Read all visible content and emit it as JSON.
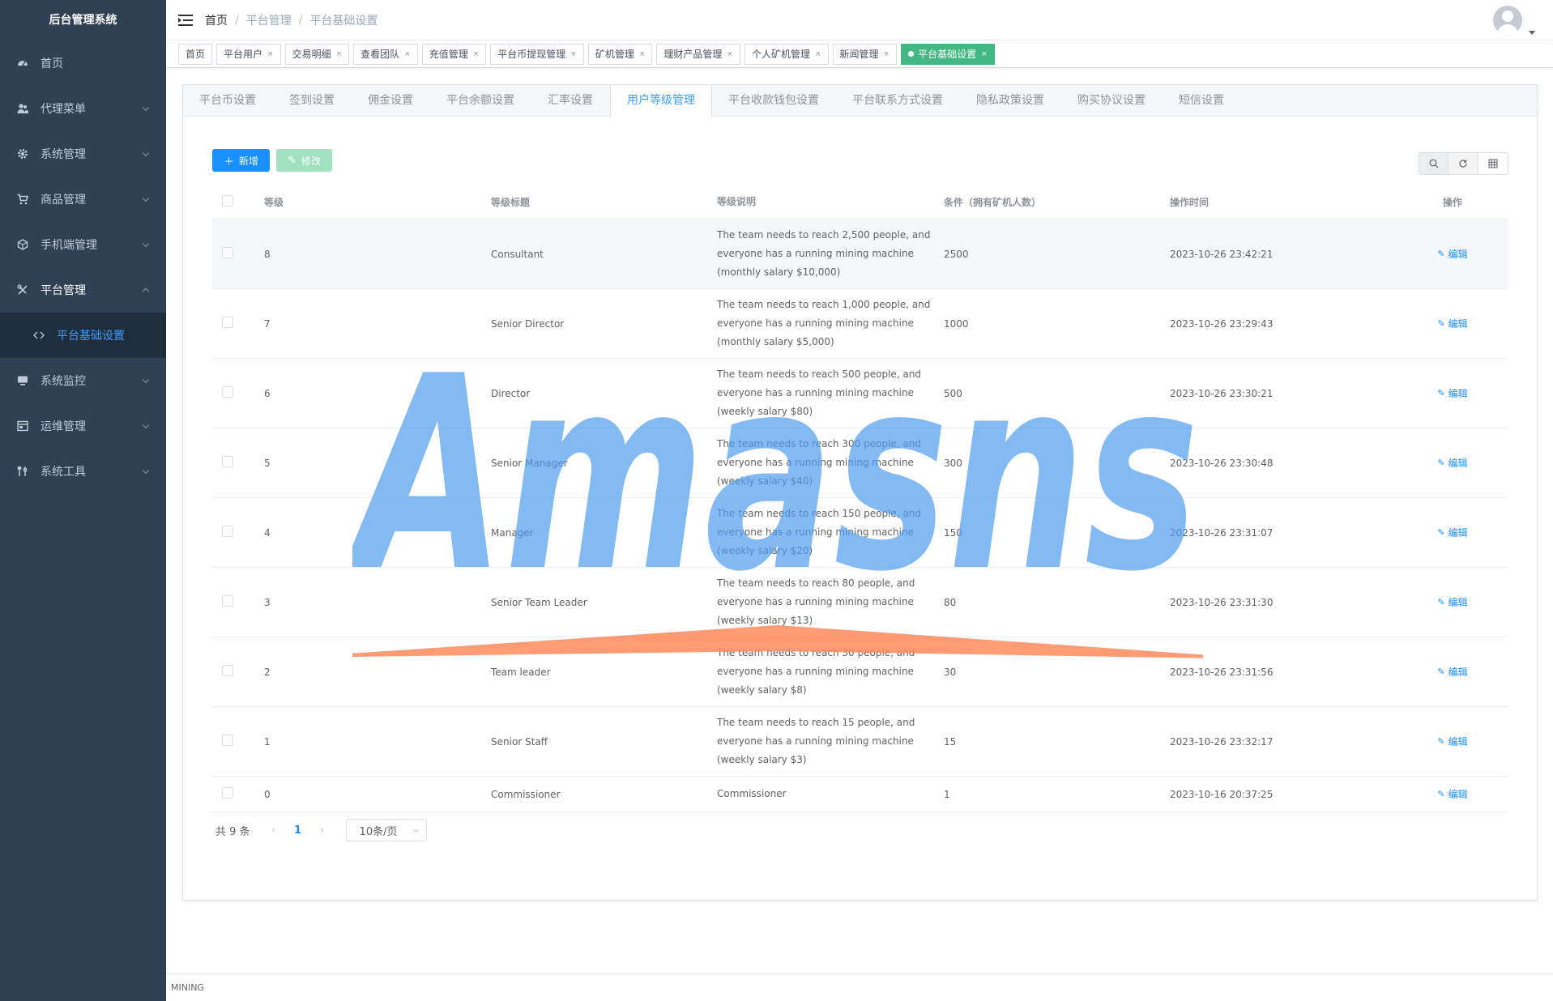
{
  "app": {
    "title": "后台管理系统"
  },
  "sidebar": {
    "items": [
      {
        "label": "首页",
        "icon": "dashboard-icon",
        "expandable": false
      },
      {
        "label": "代理菜单",
        "icon": "user-group-icon",
        "expandable": true
      },
      {
        "label": "系统管理",
        "icon": "gear-icon",
        "expandable": true
      },
      {
        "label": "商品管理",
        "icon": "cart-icon",
        "expandable": true
      },
      {
        "label": "手机端管理",
        "icon": "box-icon",
        "expandable": true
      },
      {
        "label": "平台管理",
        "icon": "tools-icon",
        "expandable": true,
        "expanded": true
      },
      {
        "label": "系统监控",
        "icon": "monitor-icon",
        "expandable": true
      },
      {
        "label": "运维管理",
        "icon": "server-icon",
        "expandable": true
      },
      {
        "label": "系统工具",
        "icon": "wrench-icon",
        "expandable": true
      }
    ],
    "sub_items": [
      {
        "label": "平台基础设置",
        "icon": "code-icon"
      }
    ]
  },
  "breadcrumb": [
    "首页",
    "平台管理",
    "平台基础设置"
  ],
  "tags": [
    {
      "label": "首页",
      "closable": false
    },
    {
      "label": "平台用户",
      "closable": true
    },
    {
      "label": "交易明细",
      "closable": true
    },
    {
      "label": "查看团队",
      "closable": true
    },
    {
      "label": "充值管理",
      "closable": true
    },
    {
      "label": "平台币提现管理",
      "closable": true
    },
    {
      "label": "矿机管理",
      "closable": true
    },
    {
      "label": "理财产品管理",
      "closable": true
    },
    {
      "label": "个人矿机管理",
      "closable": true
    },
    {
      "label": "新闻管理",
      "closable": true
    },
    {
      "label": "平台基础设置",
      "closable": true,
      "active": true
    }
  ],
  "tag_close_glyph": "×",
  "tabs": [
    "平台币设置",
    "签到设置",
    "佣金设置",
    "平台余额设置",
    "汇率设置",
    "用户等级管理",
    "平台收款钱包设置",
    "平台联系方式设置",
    "隐私政策设置",
    "购买协议设置",
    "短信设置"
  ],
  "active_tab_index": 5,
  "toolbar": {
    "add_label": "新增",
    "edit_label": "修改"
  },
  "table": {
    "columns": {
      "level": "等级",
      "title": "等级标题",
      "desc": "等级说明",
      "condition": "条件（拥有矿机人数）",
      "time": "操作时间",
      "op": "操作"
    },
    "edit_label": "编辑",
    "rows": [
      {
        "level": "8",
        "title": "Consultant",
        "desc": "The team needs to reach 2,500 people, and everyone has a running mining machine (monthly salary $10,000)",
        "condition": "2500",
        "time": "2023-10-26 23:42:21"
      },
      {
        "level": "7",
        "title": "Senior Director",
        "desc": "The team needs to reach 1,000 people, and everyone has a running mining machine (monthly salary $5,000)",
        "condition": "1000",
        "time": "2023-10-26 23:29:43"
      },
      {
        "level": "6",
        "title": "Director",
        "desc": "The team needs to reach 500 people, and everyone has a running mining machine (weekly salary $80)",
        "condition": "500",
        "time": "2023-10-26 23:30:21"
      },
      {
        "level": "5",
        "title": "Senior Manager",
        "desc": "The team needs to reach 300 people, and everyone has a running mining machine (weekly salary $40)",
        "condition": "300",
        "time": "2023-10-26 23:30:48"
      },
      {
        "level": "4",
        "title": "Manager",
        "desc": "The team needs to reach 150 people, and everyone has a running mining machine (weekly salary $20)",
        "condition": "150",
        "time": "2023-10-26 23:31:07"
      },
      {
        "level": "3",
        "title": "Senior Team Leader",
        "desc": "The team needs to reach 80 people, and everyone has a running mining machine (weekly salary $13)",
        "condition": "80",
        "time": "2023-10-26 23:31:30"
      },
      {
        "level": "2",
        "title": "Team leader",
        "desc": "The team needs to reach 30 people, and everyone has a running mining machine (weekly salary $8)",
        "condition": "30",
        "time": "2023-10-26 23:31:56"
      },
      {
        "level": "1",
        "title": "Senior Staff",
        "desc": "The team needs to reach 15 people, and everyone has a running mining machine (weekly salary $3)",
        "condition": "15",
        "time": "2023-10-26 23:32:17"
      },
      {
        "level": "0",
        "title": "Commissioner",
        "desc": "Commissioner",
        "condition": "1",
        "time": "2023-10-16 20:37:25"
      }
    ]
  },
  "pagination": {
    "total_label": "共 9 条",
    "current_page": "1",
    "page_size_label": "10条/页"
  },
  "footer": {
    "text": "MINING"
  },
  "watermark": {
    "text": "Amasns",
    "color": "#4f9df0",
    "accent_color": "#ff8a5c"
  },
  "colors": {
    "sidebar_bg": "#304156",
    "primary": "#1890ff",
    "tag_active": "#42b983"
  }
}
